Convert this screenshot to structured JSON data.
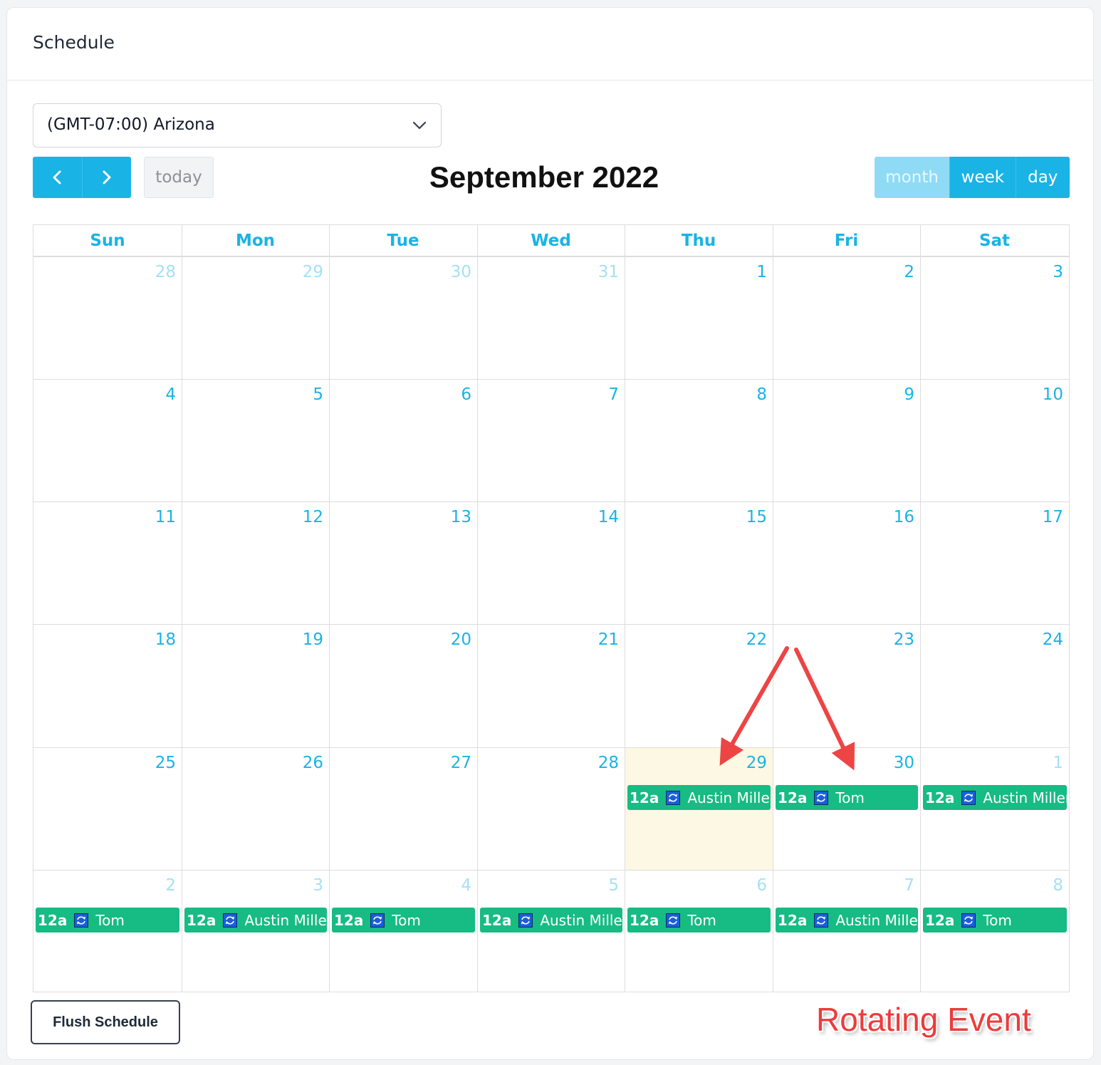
{
  "header": {
    "title": "Schedule"
  },
  "timezone": {
    "selected": "(GMT-07:00) Arizona"
  },
  "toolbar": {
    "prev_icon": "chevron-left-icon",
    "next_icon": "chevron-right-icon",
    "today_label": "today",
    "title": "September 2022",
    "views": [
      {
        "label": "month",
        "active": true
      },
      {
        "label": "week",
        "active": false
      },
      {
        "label": "day",
        "active": false
      }
    ]
  },
  "calendar": {
    "days_of_week": [
      "Sun",
      "Mon",
      "Tue",
      "Wed",
      "Thu",
      "Fri",
      "Sat"
    ],
    "weeks": [
      [
        {
          "day": "28",
          "other": true
        },
        {
          "day": "29",
          "other": true
        },
        {
          "day": "30",
          "other": true
        },
        {
          "day": "31",
          "other": true
        },
        {
          "day": "1"
        },
        {
          "day": "2"
        },
        {
          "day": "3"
        }
      ],
      [
        {
          "day": "4"
        },
        {
          "day": "5"
        },
        {
          "day": "6"
        },
        {
          "day": "7"
        },
        {
          "day": "8"
        },
        {
          "day": "9"
        },
        {
          "day": "10"
        }
      ],
      [
        {
          "day": "11"
        },
        {
          "day": "12"
        },
        {
          "day": "13"
        },
        {
          "day": "14"
        },
        {
          "day": "15"
        },
        {
          "day": "16"
        },
        {
          "day": "17"
        }
      ],
      [
        {
          "day": "18"
        },
        {
          "day": "19"
        },
        {
          "day": "20"
        },
        {
          "day": "21"
        },
        {
          "day": "22"
        },
        {
          "day": "23"
        },
        {
          "day": "24"
        }
      ],
      [
        {
          "day": "25"
        },
        {
          "day": "26"
        },
        {
          "day": "27"
        },
        {
          "day": "28"
        },
        {
          "day": "29",
          "today": true,
          "event": {
            "time": "12a",
            "title": "Austin Miller",
            "icon": "repeat-icon"
          }
        },
        {
          "day": "30",
          "event": {
            "time": "12a",
            "title": "Tom",
            "icon": "repeat-icon"
          }
        },
        {
          "day": "1",
          "other": true,
          "event": {
            "time": "12a",
            "title": "Austin Miller",
            "icon": "repeat-icon"
          }
        }
      ],
      [
        {
          "day": "2",
          "other": true,
          "event": {
            "time": "12a",
            "title": "Tom",
            "icon": "repeat-icon"
          }
        },
        {
          "day": "3",
          "other": true,
          "event": {
            "time": "12a",
            "title": "Austin Miller",
            "icon": "repeat-icon"
          }
        },
        {
          "day": "4",
          "other": true,
          "event": {
            "time": "12a",
            "title": "Tom",
            "icon": "repeat-icon"
          }
        },
        {
          "day": "5",
          "other": true,
          "event": {
            "time": "12a",
            "title": "Austin Miller",
            "icon": "repeat-icon"
          }
        },
        {
          "day": "6",
          "other": true,
          "event": {
            "time": "12a",
            "title": "Tom",
            "icon": "repeat-icon"
          }
        },
        {
          "day": "7",
          "other": true,
          "event": {
            "time": "12a",
            "title": "Austin Miller",
            "icon": "repeat-icon"
          }
        },
        {
          "day": "8",
          "other": true,
          "event": {
            "time": "12a",
            "title": "Tom",
            "icon": "repeat-icon"
          }
        }
      ]
    ]
  },
  "footer": {
    "flush_label": "Flush Schedule"
  },
  "annotation": {
    "label": "Rotating Event",
    "color": "#ee3b3b"
  },
  "colors": {
    "accent": "#1ab3e6",
    "event": "#17bb84",
    "today_bg": "#fcf8e3",
    "other_month_text": "#a6e0f5"
  }
}
